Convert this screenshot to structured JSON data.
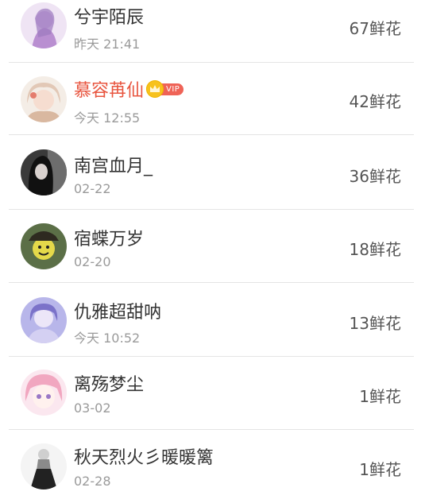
{
  "gift_unit": "鲜花",
  "rows": [
    {
      "name": "兮宇陌辰",
      "time": "昨天 21:41",
      "count": "67鲜花",
      "vip": false,
      "avatar_colors": [
        "#efe4f4",
        "#b98fd1"
      ]
    },
    {
      "name": "慕容苒仙",
      "time": "今天 12:55",
      "count": "42鲜花",
      "vip": true,
      "vip_label": "VIP",
      "avatar_colors": [
        "#f4ede6",
        "#d9b8a0"
      ]
    },
    {
      "name": "南宫血月_",
      "time": "02-22",
      "count": "36鲜花",
      "vip": false,
      "avatar_colors": [
        "#3a3a3a",
        "#111111"
      ]
    },
    {
      "name": "宿蝶万岁",
      "time": "02-20",
      "count": "18鲜花",
      "vip": false,
      "avatar_colors": [
        "#5b6f47",
        "#e5d94a"
      ]
    },
    {
      "name": "仇雅超甜呐",
      "time": "今天 10:52",
      "count": "13鲜花",
      "vip": false,
      "avatar_colors": [
        "#b8b6ea",
        "#7b72c9"
      ]
    },
    {
      "name": "离殇梦尘",
      "time": "03-02",
      "count": "1鲜花",
      "vip": false,
      "avatar_colors": [
        "#fbe7ef",
        "#f1a7c0"
      ]
    },
    {
      "name": "秋天烈火彡暖暖篱",
      "time": "02-28",
      "count": "1鲜花",
      "vip": false,
      "avatar_colors": [
        "#f4f4f4",
        "#222222"
      ]
    }
  ]
}
